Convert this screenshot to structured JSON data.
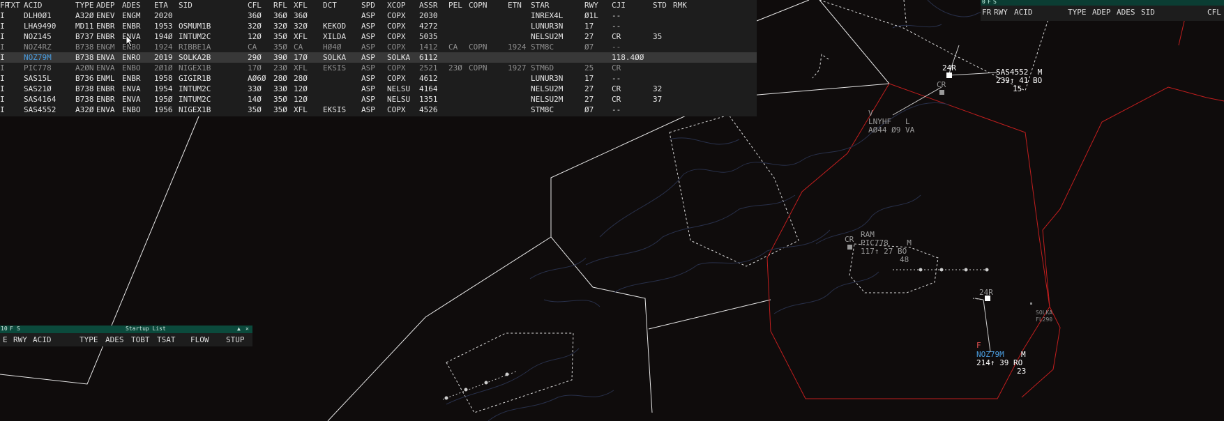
{
  "flight_list": {
    "columns": [
      "FR",
      "TXT",
      "ACID",
      "TYPE",
      "ADEP",
      "ADES",
      "ETA",
      "SID",
      "CFL",
      "RFL",
      "XFL",
      "DCT",
      "SPD",
      "XCOP",
      "ASSR",
      "PEL",
      "COPN",
      "ETN",
      "STAR",
      "RWY",
      "CJI",
      "STD",
      "RMK"
    ],
    "rows": [
      {
        "fr": "I",
        "acid": "DLH0Ø1",
        "type": "A32Ø",
        "adep": "ENEV",
        "ades": "ENGM",
        "eta": "2020",
        "sid": "",
        "cfl": "36Ø",
        "rfl": "36Ø",
        "xfl": "36Ø",
        "dct": "",
        "spd": "ASP",
        "xcop": "COPX",
        "assr": "2030",
        "pel": "",
        "copn": "",
        "etn": "",
        "star": "INREX4L",
        "rwy": "Ø1L",
        "cji": "--",
        "std": "",
        "style": "normal"
      },
      {
        "fr": "I",
        "acid": "LHA9490",
        "type": "MD11",
        "adep": "ENBR",
        "ades": "ENBR",
        "eta": "1953",
        "sid": "OSMUM1B",
        "cfl": "32Ø",
        "rfl": "32Ø",
        "xfl": "32Ø",
        "dct": "KEKOD",
        "spd": "ASP",
        "xcop": "COPX",
        "assr": "4272",
        "pel": "",
        "copn": "",
        "etn": "",
        "star": "LUNUR3N",
        "rwy": "17",
        "cji": "--",
        "std": "",
        "style": "normal"
      },
      {
        "fr": "I",
        "acid": "NOZ145",
        "type": "B737",
        "adep": "ENBR",
        "ades": "ENVA",
        "eta": "194Ø",
        "sid": "INTUM2C",
        "cfl": "12Ø",
        "rfl": "35Ø",
        "xfl": "XFL",
        "dct": "XILDA",
        "spd": "ASP",
        "xcop": "COPX",
        "assr": "5035",
        "pel": "",
        "copn": "",
        "etn": "",
        "star": "NELSU2M",
        "rwy": "27",
        "cji": "CR",
        "std": "35",
        "style": "normal"
      },
      {
        "fr": "I",
        "acid": "NOZ4RZ",
        "type": "B738",
        "adep": "ENGM",
        "ades": "ENBO",
        "eta": "1924",
        "sid": "RIBBE1A",
        "cfl": "CA",
        "rfl": "35Ø",
        "xfl": "CA",
        "dct": "HØ4Ø",
        "spd": "ASP",
        "xcop": "COPX",
        "assr": "1412",
        "pel": "CA",
        "copn": "COPN",
        "etn": "1924",
        "star": "STM8C",
        "rwy": "Ø7",
        "cji": "--",
        "std": "",
        "style": "dim"
      },
      {
        "fr": "I",
        "acid": "NOZ79M",
        "type": "B738",
        "adep": "ENVA",
        "ades": "ENRO",
        "eta": "2019",
        "sid": "SOLKA2B",
        "cfl": "29Ø",
        "rfl": "39Ø",
        "xfl": "17Ø",
        "dct": "SOLKA",
        "spd": "ASP",
        "xcop": "SOLKA",
        "assr": "6112",
        "pel": "",
        "copn": "",
        "etn": "",
        "star": "",
        "rwy": "",
        "cji": "118.4ØØ",
        "std": "",
        "style": "selected"
      },
      {
        "fr": "I",
        "acid": "PIC778",
        "type": "A2ØN",
        "adep": "ENVA",
        "ades": "ENBO",
        "eta": "2Ø1Ø",
        "sid": "NIGEX1B",
        "cfl": "17Ø",
        "rfl": "23Ø",
        "xfl": "XFL",
        "dct": "EKSIS",
        "spd": "ASP",
        "xcop": "COPX",
        "assr": "2521",
        "pel": "23Ø",
        "copn": "COPN",
        "etn": "1927",
        "star": "STM6D",
        "rwy": "25",
        "cji": "CR",
        "std": "",
        "style": "dim"
      },
      {
        "fr": "I",
        "acid": "SAS15L",
        "type": "B736",
        "adep": "ENML",
        "ades": "ENBR",
        "eta": "1958",
        "sid": "GIGIR1B",
        "cfl": "AØ6Ø",
        "rfl": "28Ø",
        "xfl": "28Ø",
        "dct": "",
        "spd": "ASP",
        "xcop": "COPX",
        "assr": "4612",
        "pel": "",
        "copn": "",
        "etn": "",
        "star": "LUNUR3N",
        "rwy": "17",
        "cji": "--",
        "std": "",
        "style": "normal"
      },
      {
        "fr": "I",
        "acid": "SAS21Ø",
        "type": "B738",
        "adep": "ENBR",
        "ades": "ENVA",
        "eta": "1954",
        "sid": "INTUM2C",
        "cfl": "33Ø",
        "rfl": "33Ø",
        "xfl": "12Ø",
        "dct": "",
        "spd": "ASP",
        "xcop": "NELSU",
        "assr": "4164",
        "pel": "",
        "copn": "",
        "etn": "",
        "star": "NELSU2M",
        "rwy": "27",
        "cji": "CR",
        "std": "32",
        "style": "normal"
      },
      {
        "fr": "I",
        "acid": "SAS4164",
        "type": "B738",
        "adep": "ENBR",
        "ades": "ENVA",
        "eta": "195Ø",
        "sid": "INTUM2C",
        "cfl": "14Ø",
        "rfl": "35Ø",
        "xfl": "12Ø",
        "dct": "",
        "spd": "ASP",
        "xcop": "NELSU",
        "assr": "1351",
        "pel": "",
        "copn": "",
        "etn": "",
        "star": "NELSU2M",
        "rwy": "27",
        "cji": "CR",
        "std": "37",
        "style": "normal"
      },
      {
        "fr": "I",
        "acid": "SAS4552",
        "type": "A32Ø",
        "adep": "ENVA",
        "ades": "ENBO",
        "eta": "1956",
        "sid": "NIGEX1B",
        "cfl": "35Ø",
        "rfl": "35Ø",
        "xfl": "XFL",
        "dct": "EKSIS",
        "spd": "ASP",
        "xcop": "COPX",
        "assr": "4526",
        "pel": "",
        "copn": "",
        "etn": "",
        "star": "STM8C",
        "rwy": "Ø7",
        "cji": "--",
        "std": "",
        "style": "normal"
      }
    ]
  },
  "sequence_list": {
    "titlebar": [
      "0",
      "F",
      "S"
    ],
    "columns": [
      "FR",
      "RWY",
      "ACID",
      "TYPE",
      "ADEP",
      "ADES",
      "SID",
      "CFL"
    ]
  },
  "startup_list": {
    "title": "Startup List",
    "titlebar_left": [
      "10",
      "F",
      "S"
    ],
    "columns": [
      "E",
      "RWY",
      "ACID",
      "TYPE",
      "ADES",
      "TOBT",
      "TSAT",
      "FLOW",
      "STUP"
    ]
  },
  "radar_labels": {
    "sas4552": {
      "rwy": "24R",
      "line1": "SAS4552  M",
      "line2": "239↑ 41 BO",
      "line3": "15"
    },
    "cr_top": "CR",
    "lnyhf": {
      "line1": "V",
      "line2": "LNYHF   L",
      "line3": "AØ44 Ø9 VA"
    },
    "pic778": {
      "cr": "CR",
      "line1": "RAM",
      "line2": "PIC778    M",
      "line3": "117↑ 27 BO",
      "line4": "48"
    },
    "noz79m": {
      "rwy": "24R",
      "f": "F",
      "line1": "NOZ79M",
      "line1b": "M",
      "line2": "214↑ 39 RO",
      "line3": "23"
    },
    "solka": {
      "name": "SOLKA",
      "fl": "FL290"
    }
  },
  "colors": {
    "background": "#0f0c0c",
    "list_bg": "#1d1d1d",
    "selected_row": "#383838",
    "callsign_blue": "#4a9de0",
    "sector_red": "#c21e1e",
    "coast": "#28304a",
    "titlebar_green": "#0b4a3c"
  }
}
